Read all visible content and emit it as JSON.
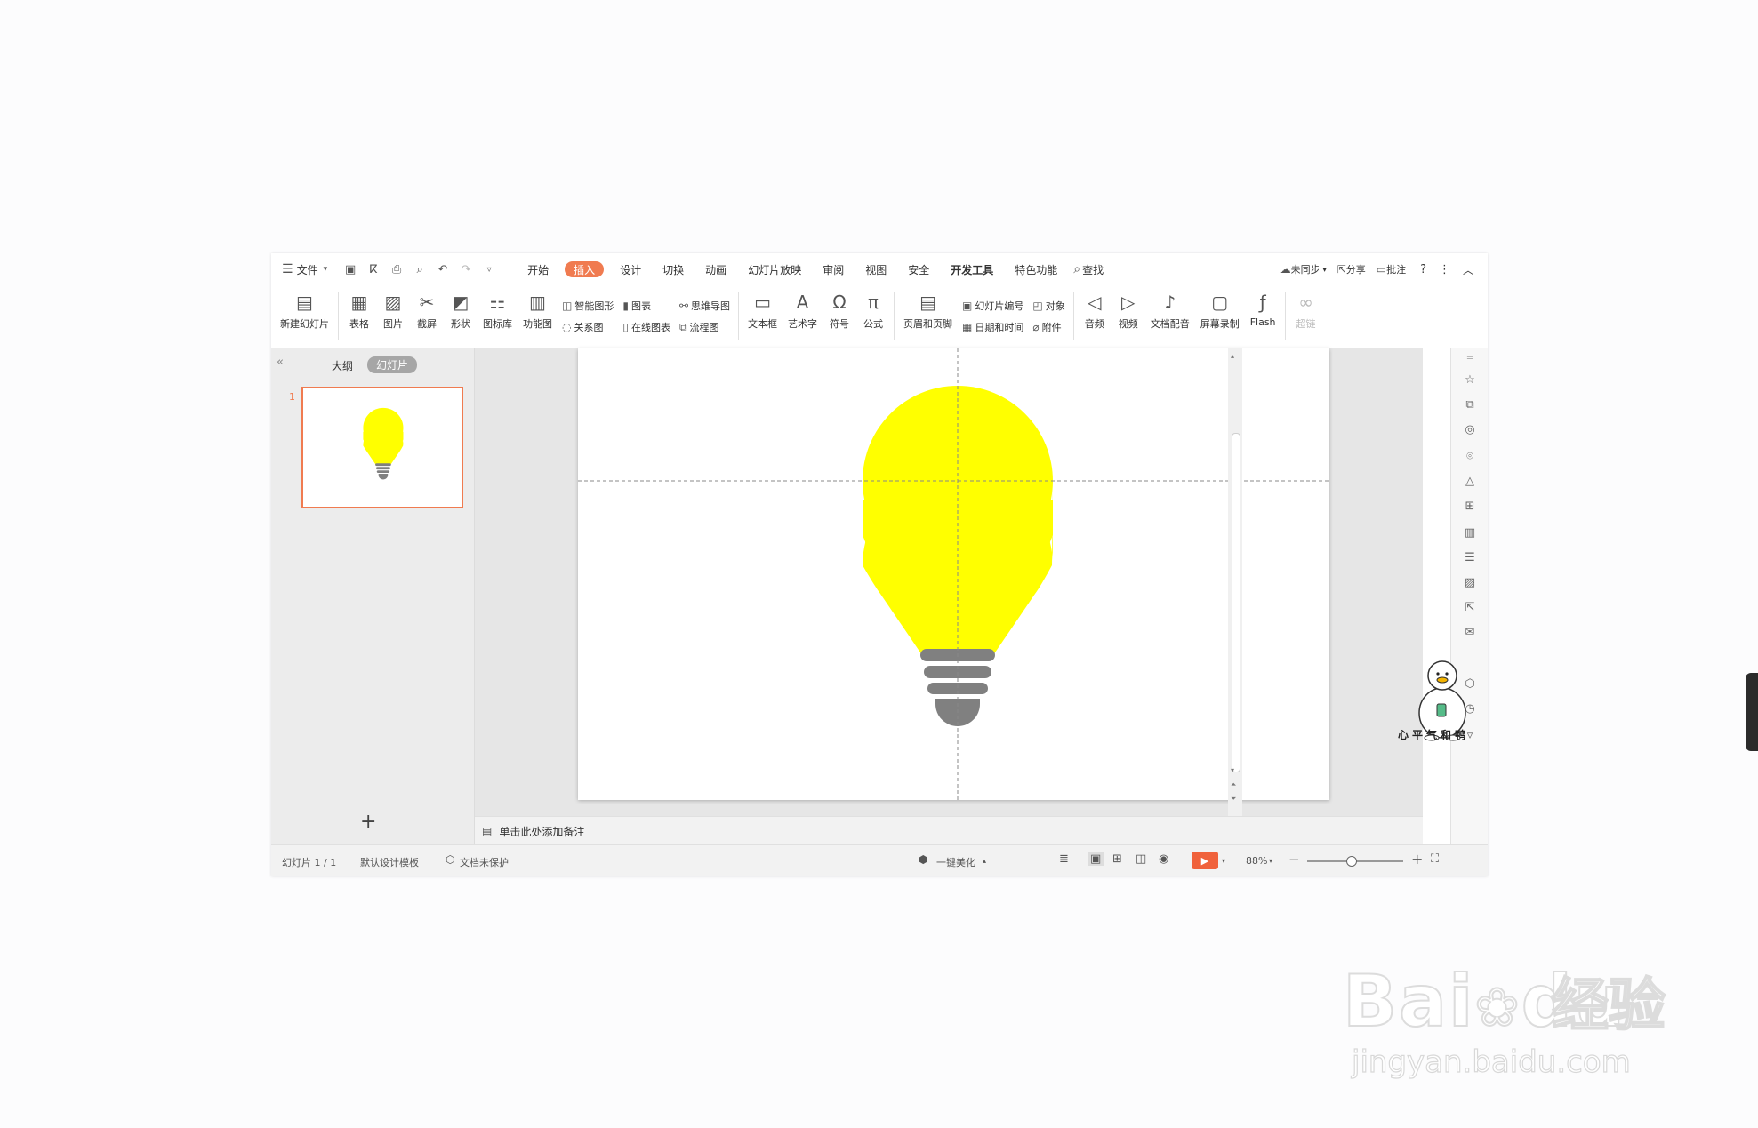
{
  "menubar": {
    "file_label": "文件",
    "tabs": [
      "开始",
      "插入",
      "设计",
      "切换",
      "动画",
      "幻灯片放映",
      "审阅",
      "视图",
      "安全",
      "开发工具",
      "特色功能"
    ],
    "search_label": "查找",
    "sync_label": "未同步",
    "share_label": "分享",
    "comment_label": "批注",
    "help_label": "?"
  },
  "ribbon": {
    "new_slide": "新建幻灯片",
    "table": "表格",
    "picture": "图片",
    "screenshot": "截屏",
    "shape": "形状",
    "icon_lib": "图标库",
    "function_chart": "功能图",
    "smart_graphic": "智能图形",
    "chart": "图表",
    "relation": "关系图",
    "online_chart": "在线图表",
    "mindmap": "思维导图",
    "flowchart": "流程图",
    "textbox": "文本框",
    "wordart": "艺术字",
    "symbol": "符号",
    "formula": "公式",
    "header_footer": "页眉和页脚",
    "slide_number": "幻灯片编号",
    "object": "对象",
    "datetime": "日期和时间",
    "attachment": "附件",
    "audio": "音频",
    "video": "视频",
    "doc_dub": "文档配音",
    "screen_record": "屏幕录制",
    "flash": "Flash",
    "hyperlink": "超链"
  },
  "leftpanel": {
    "outline_tab": "大纲",
    "slides_tab": "幻灯片",
    "slide_number": "1",
    "add_slide": "+"
  },
  "notes": {
    "placeholder": "单击此处添加备注"
  },
  "statusbar": {
    "slide_info": "幻灯片 1 / 1",
    "template": "默认设计模板",
    "protection": "文档未保护",
    "beautify": "一键美化",
    "zoom": "88%",
    "zoom_fraction": 0.45
  },
  "colors": {
    "accent": "#f07b50",
    "bulb": "#ffff00",
    "base": "#808080"
  },
  "watermark": {
    "logo": "Bai",
    "logo2": "du",
    "cn": "经验",
    "url": "jingyan.baidu.com"
  },
  "duck_text": "心平气和鸭"
}
